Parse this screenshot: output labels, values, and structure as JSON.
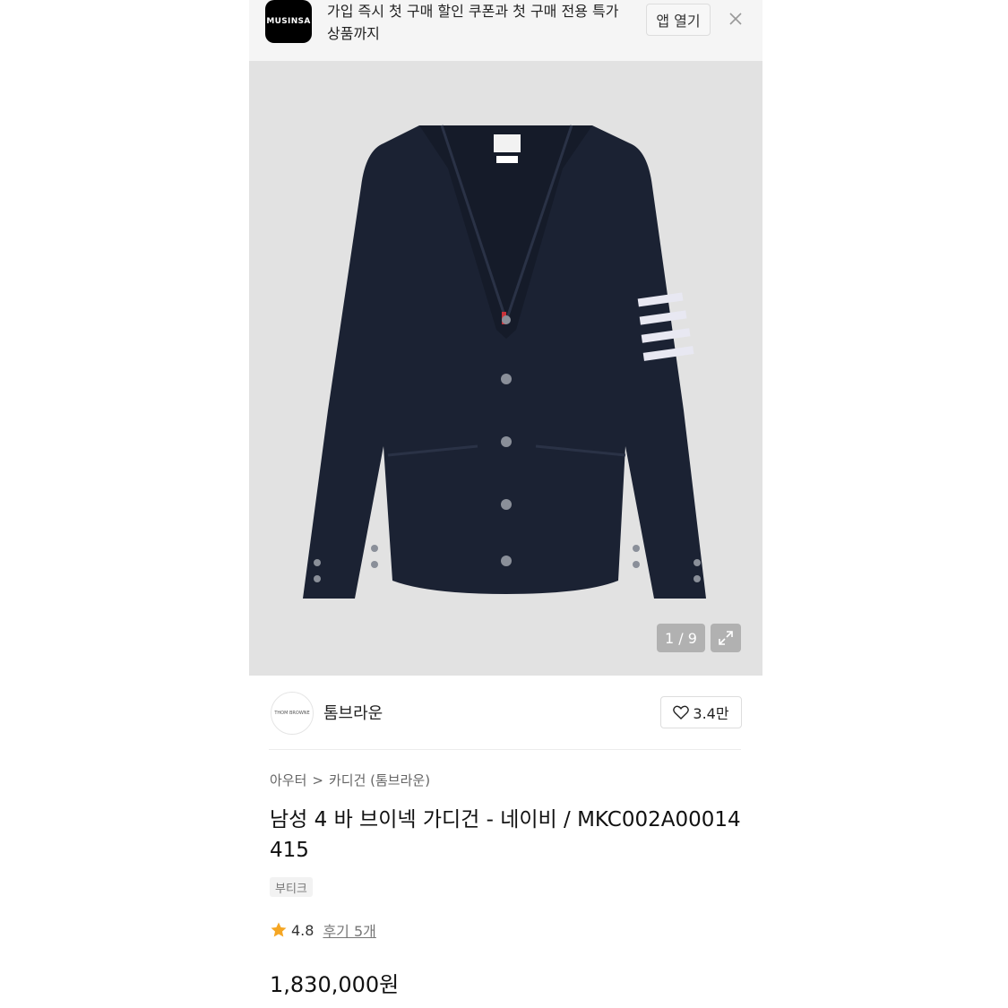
{
  "banner": {
    "app_logo_text": "MUSINSA",
    "message": "가입 즉시 첫 구매 할인 쿠폰과 첫 구매 전용 특가 상품까지",
    "open_app_label": "앱 열기",
    "close_icon": "close-icon"
  },
  "gallery": {
    "counter": "1 / 9",
    "expand_icon": "expand-icon"
  },
  "brand": {
    "name": "톰브라운",
    "logo_text": "THOM BROWNE",
    "likes": "3.4만",
    "like_icon": "heart-icon"
  },
  "breadcrumb": {
    "level1": "아우터",
    "separator": ">",
    "level2": "카디건 (톰브라운)"
  },
  "product": {
    "title": "남성 4 바 브이넥 가디건 - 네이비 / MKC002A00014415",
    "tag": "부티크",
    "rating": "4.8",
    "reviews": "후기 5개",
    "price": "1,830,000원"
  },
  "colors": {
    "star": "#f5a623",
    "cardigan": "#1b2233",
    "background": "#e2e2e2"
  }
}
